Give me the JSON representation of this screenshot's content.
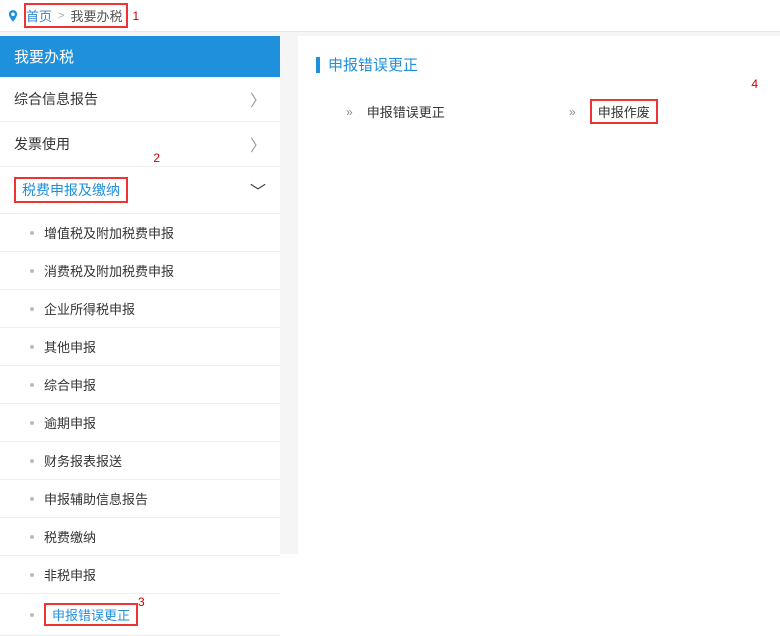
{
  "breadcrumb": {
    "home": "首页",
    "current": "我要办税",
    "annot1": "1"
  },
  "sidebar": {
    "title": "我要办税",
    "items": [
      {
        "label": "综合信息报告",
        "chev": "〉"
      },
      {
        "label": "发票使用",
        "chev": "〉"
      },
      {
        "label": "税费申报及缴纳",
        "chev": "﹀",
        "annot": "2"
      }
    ],
    "sub": [
      {
        "label": "增值税及附加税费申报"
      },
      {
        "label": "消费税及附加税费申报"
      },
      {
        "label": "企业所得税申报"
      },
      {
        "label": "其他申报"
      },
      {
        "label": "综合申报"
      },
      {
        "label": "逾期申报"
      },
      {
        "label": "财务报表报送"
      },
      {
        "label": "申报辅助信息报告"
      },
      {
        "label": "税费缴纳"
      },
      {
        "label": "非税申报"
      },
      {
        "label": "申报错误更正",
        "active": true,
        "annot": "3"
      }
    ]
  },
  "content": {
    "section_title": "申报错误更正",
    "links": [
      {
        "label": "申报错误更正"
      },
      {
        "label": "申报作废",
        "boxed": true,
        "annot": "4"
      }
    ]
  }
}
